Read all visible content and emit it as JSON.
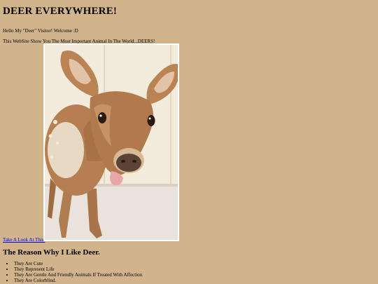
{
  "page": {
    "title": "DEER EVERYWHERE!",
    "greeting": "Hello My \"Deer\" Visitor! Welcome :D",
    "intro": "This WebSite Show You The Most Important Animal In The World...DEERS!",
    "photo_link": "Take A Look At This.",
    "reason_heading": "The Reason Why I Like Deer.",
    "reasons": [
      "They Are Cute",
      "They Represent Life",
      "They Are Gentle And Friendly Animals If Treated With Affection",
      "They Are Colorblind."
    ]
  },
  "colors": {
    "background": "#d2b48c",
    "link": "#0000ee"
  },
  "image": {
    "subject": "fawn-photo"
  }
}
